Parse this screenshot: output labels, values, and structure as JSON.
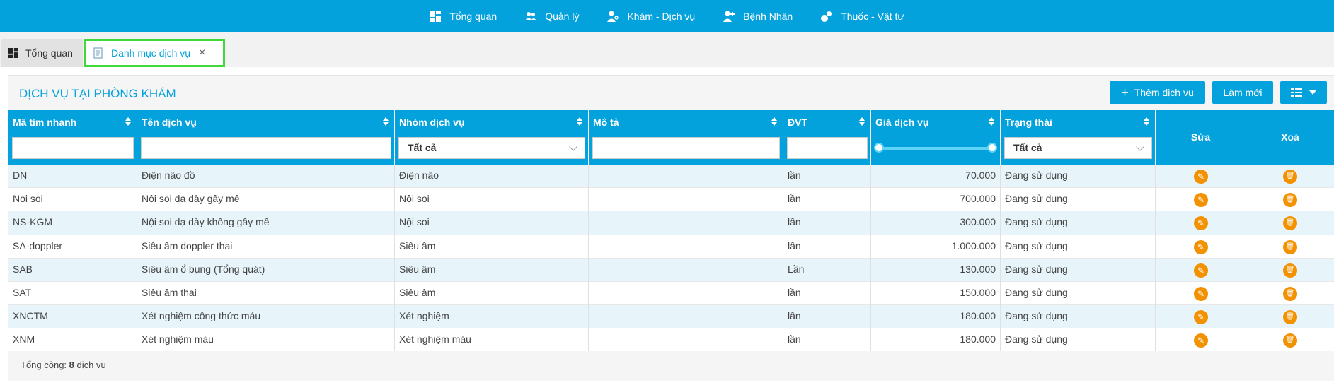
{
  "nav": {
    "items": [
      {
        "label": "Tổng quan",
        "icon": "dashboard-icon"
      },
      {
        "label": "Quản lý",
        "icon": "users-icon"
      },
      {
        "label": "Khám - Dịch vụ",
        "icon": "doctor-icon"
      },
      {
        "label": "Bệnh Nhân",
        "icon": "patient-icon"
      },
      {
        "label": "Thuốc - Vật tư",
        "icon": "medicine-icon"
      }
    ]
  },
  "tabs": [
    {
      "label": "Tổng quan",
      "icon": "dashboard-icon"
    },
    {
      "label": "Danh mục dịch vụ",
      "icon": "list-icon",
      "closable": true
    }
  ],
  "panel": {
    "title": "DỊCH VỤ TẠI PHÒNG KHÁM",
    "add_label": "Thêm dịch vụ",
    "refresh_label": "Làm mới"
  },
  "table": {
    "headers": [
      "Mã tìm nhanh",
      "Tên dịch vụ",
      "Nhóm dịch vụ",
      "Mô tả",
      "ĐVT",
      "Giá dịch vụ",
      "Trạng thái",
      "Sửa",
      "Xoá"
    ],
    "filter_group": "Tất cả",
    "filter_status": "Tất cả",
    "rows": [
      [
        "DN",
        "Điện não đồ",
        "Điện não",
        "",
        "lần",
        "70.000",
        "Đang sử dụng"
      ],
      [
        "Noi soi",
        "Nội soi dạ dày gây mê",
        "Nội soi",
        "",
        "lần",
        "700.000",
        "Đang sử dụng"
      ],
      [
        "NS-KGM",
        "Nội soi dạ dày không gây mê",
        "Nội soi",
        "",
        "lần",
        "300.000",
        "Đang sử dụng"
      ],
      [
        "SA-doppler",
        "Siêu âm doppler thai",
        "Siêu âm",
        "",
        "lần",
        "1.000.000",
        "Đang sử dụng"
      ],
      [
        "SAB",
        "Siêu âm ổ bụng (Tổng quát)",
        "Siêu âm",
        "",
        "Lần",
        "130.000",
        "Đang sử dụng"
      ],
      [
        "SAT",
        "Siêu âm thai",
        "Siêu âm",
        "",
        "lần",
        "150.000",
        "Đang sử dụng"
      ],
      [
        "XNCTM",
        "Xét nghiệm công thức máu",
        "Xét nghiệm",
        "",
        "lần",
        "180.000",
        "Đang sử dụng"
      ],
      [
        "XNM",
        "Xét nghiệm máu",
        "Xét nghiệm máu",
        "",
        "lần",
        "180.000",
        "Đang sử dụng"
      ]
    ]
  },
  "footer": {
    "prefix": "Tổng cộng: ",
    "count": "8",
    "suffix": " dịch vụ"
  },
  "colors": {
    "primary": "#03a2dc",
    "action": "#f39200",
    "highlight": "#41d83a"
  }
}
